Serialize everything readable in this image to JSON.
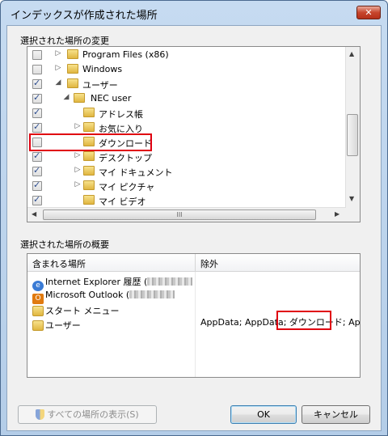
{
  "window": {
    "title": "インデックスが作成された場所",
    "close_label": "✕"
  },
  "tree_group": {
    "label": "選択された場所の変更"
  },
  "tree": [
    {
      "label": "Program Files (x86)",
      "checked": false,
      "expander": "▷",
      "level": 1
    },
    {
      "label": "Windows",
      "checked": false,
      "expander": "▷",
      "level": 1
    },
    {
      "label": "ユーザー",
      "checked": true,
      "expander": "◢",
      "level": 1
    },
    {
      "label": "NEC user",
      "checked": true,
      "expander": "◢",
      "level": 2
    },
    {
      "label": "アドレス帳",
      "checked": true,
      "expander": "",
      "level": 3
    },
    {
      "label": "お気に入り",
      "checked": true,
      "expander": "▷",
      "level": 3
    },
    {
      "label": "ダウンロード",
      "checked": false,
      "expander": "",
      "level": 3,
      "highlight": true
    },
    {
      "label": "デスクトップ",
      "checked": true,
      "expander": "▷",
      "level": 3
    },
    {
      "label": "マイ ドキュメント",
      "checked": true,
      "expander": "▷",
      "level": 3
    },
    {
      "label": "マイ ピクチャ",
      "checked": true,
      "expander": "▷",
      "level": 3
    },
    {
      "label": "マイ ビデオ",
      "checked": true,
      "expander": "",
      "level": 3
    }
  ],
  "scroll": {
    "up": "▲",
    "down": "▼",
    "left": "◀",
    "right": "▶",
    "grip": "III"
  },
  "summary_group": {
    "label": "選択された場所の概要"
  },
  "summary": {
    "col_included": "含まれる場所",
    "col_excluded": "除外",
    "rows": [
      {
        "label": "Internet Explorer 履歴 (",
        "icon": "ie-icon",
        "redacted": true
      },
      {
        "label": "Microsoft Outlook (",
        "icon": "outlook-icon",
        "redacted": true
      },
      {
        "label": "スタート メニュー",
        "icon": "folder-icon",
        "redacted": false
      },
      {
        "label": "ユーザー",
        "icon": "folder-icon",
        "redacted": false
      }
    ],
    "excluded_prefix": "AppData; AppData; ",
    "excluded_highlight": "ダウンロード;",
    "excluded_suffix": " App..."
  },
  "buttons": {
    "show_all": "すべての場所の表示(S)",
    "ok": "OK",
    "cancel": "キャンセル"
  },
  "colors": {
    "highlight_red": "#e00010",
    "titlebar": "#c6dbf1"
  }
}
